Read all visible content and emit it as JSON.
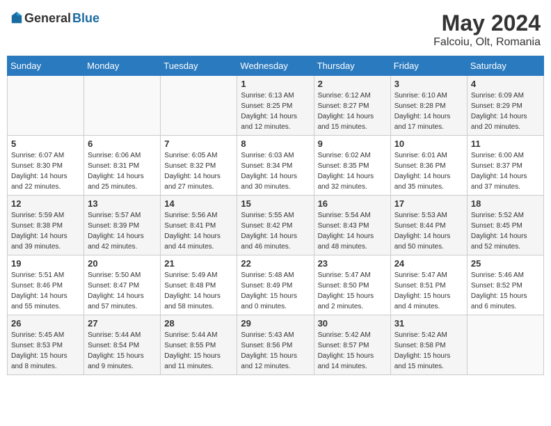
{
  "header": {
    "logo_general": "General",
    "logo_blue": "Blue",
    "month_year": "May 2024",
    "location": "Falcoiu, Olt, Romania"
  },
  "days_of_week": [
    "Sunday",
    "Monday",
    "Tuesday",
    "Wednesday",
    "Thursday",
    "Friday",
    "Saturday"
  ],
  "weeks": [
    {
      "days": [
        {
          "number": "",
          "info": ""
        },
        {
          "number": "",
          "info": ""
        },
        {
          "number": "",
          "info": ""
        },
        {
          "number": "1",
          "info": "Sunrise: 6:13 AM\nSunset: 8:25 PM\nDaylight: 14 hours and 12 minutes."
        },
        {
          "number": "2",
          "info": "Sunrise: 6:12 AM\nSunset: 8:27 PM\nDaylight: 14 hours and 15 minutes."
        },
        {
          "number": "3",
          "info": "Sunrise: 6:10 AM\nSunset: 8:28 PM\nDaylight: 14 hours and 17 minutes."
        },
        {
          "number": "4",
          "info": "Sunrise: 6:09 AM\nSunset: 8:29 PM\nDaylight: 14 hours and 20 minutes."
        }
      ]
    },
    {
      "days": [
        {
          "number": "5",
          "info": "Sunrise: 6:07 AM\nSunset: 8:30 PM\nDaylight: 14 hours and 22 minutes."
        },
        {
          "number": "6",
          "info": "Sunrise: 6:06 AM\nSunset: 8:31 PM\nDaylight: 14 hours and 25 minutes."
        },
        {
          "number": "7",
          "info": "Sunrise: 6:05 AM\nSunset: 8:32 PM\nDaylight: 14 hours and 27 minutes."
        },
        {
          "number": "8",
          "info": "Sunrise: 6:03 AM\nSunset: 8:34 PM\nDaylight: 14 hours and 30 minutes."
        },
        {
          "number": "9",
          "info": "Sunrise: 6:02 AM\nSunset: 8:35 PM\nDaylight: 14 hours and 32 minutes."
        },
        {
          "number": "10",
          "info": "Sunrise: 6:01 AM\nSunset: 8:36 PM\nDaylight: 14 hours and 35 minutes."
        },
        {
          "number": "11",
          "info": "Sunrise: 6:00 AM\nSunset: 8:37 PM\nDaylight: 14 hours and 37 minutes."
        }
      ]
    },
    {
      "days": [
        {
          "number": "12",
          "info": "Sunrise: 5:59 AM\nSunset: 8:38 PM\nDaylight: 14 hours and 39 minutes."
        },
        {
          "number": "13",
          "info": "Sunrise: 5:57 AM\nSunset: 8:39 PM\nDaylight: 14 hours and 42 minutes."
        },
        {
          "number": "14",
          "info": "Sunrise: 5:56 AM\nSunset: 8:41 PM\nDaylight: 14 hours and 44 minutes."
        },
        {
          "number": "15",
          "info": "Sunrise: 5:55 AM\nSunset: 8:42 PM\nDaylight: 14 hours and 46 minutes."
        },
        {
          "number": "16",
          "info": "Sunrise: 5:54 AM\nSunset: 8:43 PM\nDaylight: 14 hours and 48 minutes."
        },
        {
          "number": "17",
          "info": "Sunrise: 5:53 AM\nSunset: 8:44 PM\nDaylight: 14 hours and 50 minutes."
        },
        {
          "number": "18",
          "info": "Sunrise: 5:52 AM\nSunset: 8:45 PM\nDaylight: 14 hours and 52 minutes."
        }
      ]
    },
    {
      "days": [
        {
          "number": "19",
          "info": "Sunrise: 5:51 AM\nSunset: 8:46 PM\nDaylight: 14 hours and 55 minutes."
        },
        {
          "number": "20",
          "info": "Sunrise: 5:50 AM\nSunset: 8:47 PM\nDaylight: 14 hours and 57 minutes."
        },
        {
          "number": "21",
          "info": "Sunrise: 5:49 AM\nSunset: 8:48 PM\nDaylight: 14 hours and 58 minutes."
        },
        {
          "number": "22",
          "info": "Sunrise: 5:48 AM\nSunset: 8:49 PM\nDaylight: 15 hours and 0 minutes."
        },
        {
          "number": "23",
          "info": "Sunrise: 5:47 AM\nSunset: 8:50 PM\nDaylight: 15 hours and 2 minutes."
        },
        {
          "number": "24",
          "info": "Sunrise: 5:47 AM\nSunset: 8:51 PM\nDaylight: 15 hours and 4 minutes."
        },
        {
          "number": "25",
          "info": "Sunrise: 5:46 AM\nSunset: 8:52 PM\nDaylight: 15 hours and 6 minutes."
        }
      ]
    },
    {
      "days": [
        {
          "number": "26",
          "info": "Sunrise: 5:45 AM\nSunset: 8:53 PM\nDaylight: 15 hours and 8 minutes."
        },
        {
          "number": "27",
          "info": "Sunrise: 5:44 AM\nSunset: 8:54 PM\nDaylight: 15 hours and 9 minutes."
        },
        {
          "number": "28",
          "info": "Sunrise: 5:44 AM\nSunset: 8:55 PM\nDaylight: 15 hours and 11 minutes."
        },
        {
          "number": "29",
          "info": "Sunrise: 5:43 AM\nSunset: 8:56 PM\nDaylight: 15 hours and 12 minutes."
        },
        {
          "number": "30",
          "info": "Sunrise: 5:42 AM\nSunset: 8:57 PM\nDaylight: 15 hours and 14 minutes."
        },
        {
          "number": "31",
          "info": "Sunrise: 5:42 AM\nSunset: 8:58 PM\nDaylight: 15 hours and 15 minutes."
        },
        {
          "number": "",
          "info": ""
        }
      ]
    }
  ]
}
